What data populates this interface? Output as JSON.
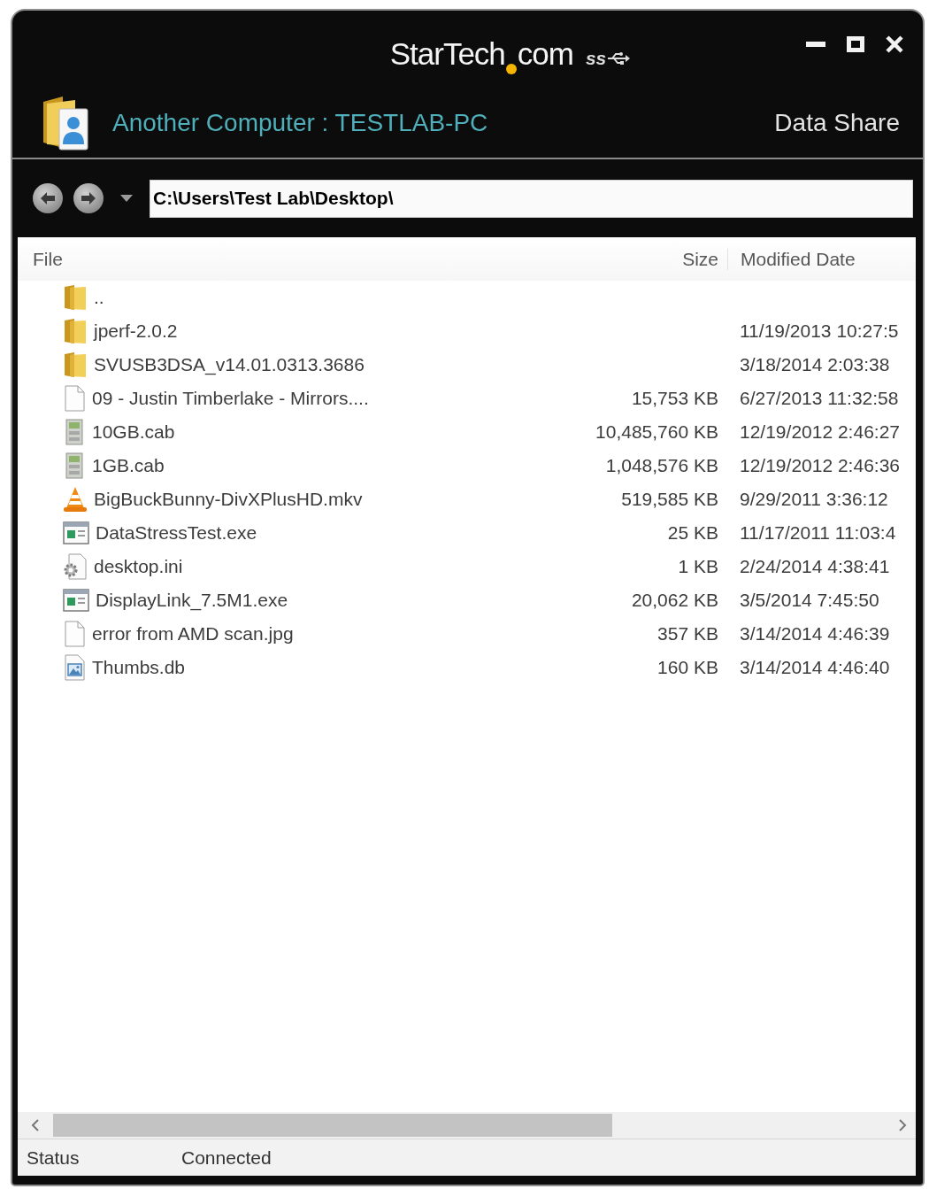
{
  "title_bar": {
    "logo_name": "StarTech",
    "logo_suffix": "com",
    "usb_badge": "ss"
  },
  "header": {
    "connection": "Another Computer : TESTLAB-PC",
    "mode": "Data Share"
  },
  "address_bar": {
    "path": "C:\\Users\\Test Lab\\Desktop\\"
  },
  "file_list": {
    "columns": [
      "File",
      "Size",
      "Modified Date"
    ],
    "rows": [
      {
        "kind": "folder",
        "name": ".."
      },
      {
        "kind": "folder",
        "name": "jperf-2.0.2",
        "date": "11/19/2013 10:27:5"
      },
      {
        "kind": "folder",
        "name": "SVUSB3DSA_v14.01.0313.3686",
        "date": "3/18/2014 2:03:38"
      },
      {
        "kind": "file",
        "name": "09 - Justin Timberlake - Mirrors....",
        "size": "15,753 KB",
        "date": "6/27/2013 11:32:58"
      },
      {
        "kind": "archive",
        "name": "10GB.cab",
        "size": "10,485,760 KB",
        "date": "12/19/2012 2:46:27"
      },
      {
        "kind": "archive",
        "name": "1GB.cab",
        "size": "1,048,576 KB",
        "date": "12/19/2012 2:46:36"
      },
      {
        "kind": "video",
        "name": "BigBuckBunny-DivXPlusHD.mkv",
        "size": "519,585 KB",
        "date": "9/29/2011 3:36:12"
      },
      {
        "kind": "program",
        "name": "DataStressTest.exe",
        "size": "25 KB",
        "date": "11/17/2011 11:03:4"
      },
      {
        "kind": "settings",
        "name": "desktop.ini",
        "size": "1 KB",
        "date": "2/24/2014 4:38:41"
      },
      {
        "kind": "program",
        "name": "DisplayLink_7.5M1.exe",
        "size": "20,062 KB",
        "date": "3/5/2014 7:45:50"
      },
      {
        "kind": "file",
        "name": "error from AMD scan.jpg",
        "size": "357 KB",
        "date": "3/14/2014 4:46:39"
      },
      {
        "kind": "database",
        "name": "Thumbs.db",
        "size": "160 KB",
        "date": "3/14/2014 4:46:40"
      }
    ]
  },
  "status_bar": {
    "label": "Status",
    "value": "Connected"
  }
}
